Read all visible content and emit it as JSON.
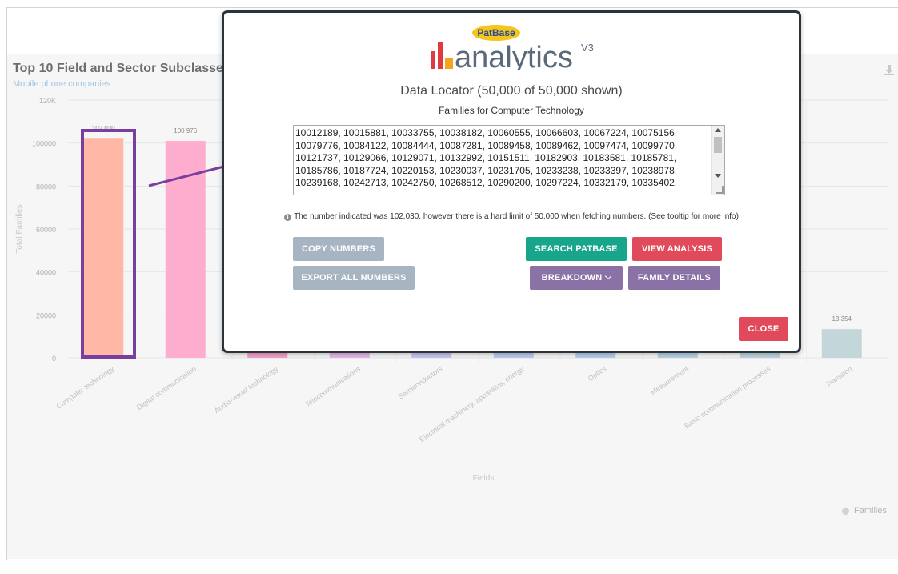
{
  "chart": {
    "title": "Top 10 Field and Sector Subclasses",
    "subtitle": "Mobile phone companies",
    "download_icon": "download-icon",
    "legend_label": "Families"
  },
  "chart_data": {
    "type": "bar",
    "title": "Top 10 Field and Sector Subclasses",
    "subtitle": "Mobile phone companies",
    "xlabel": "Fields",
    "ylabel": "Total Families",
    "ylim": [
      0,
      120000
    ],
    "yticks": [
      "0",
      "20000",
      "40000",
      "60000",
      "80000",
      "100000",
      "120K"
    ],
    "categories": [
      "Computer technology",
      "Digital communication",
      "Audio-visual technology",
      "Telecommunications",
      "Semiconductors",
      "Electrical machinery, apparatus, energy",
      "Optics",
      "Measurement",
      "Basic communication processes",
      "Transport"
    ],
    "series": [
      {
        "name": "Families",
        "values": [
          102030,
          100976,
          0,
          0,
          0,
          0,
          0,
          0,
          0,
          13354
        ]
      }
    ],
    "data_labels": [
      "102 030",
      "100 976",
      "",
      "",
      "",
      "",
      "",
      "",
      "",
      "13 354"
    ],
    "bar_colors": [
      "#ffb8a6",
      "#ffadcf",
      "#f3a1c8",
      "#e3b9e6",
      "#c9c5ee",
      "#b9cdee",
      "#b5cdec",
      "#b7d2e6",
      "#bcd5dd",
      "#c3d7da"
    ],
    "grid": true,
    "legend_placement": "bottom-right"
  },
  "modal": {
    "logo_brand": "PatBase",
    "logo_word": "analytics",
    "logo_version": "V3",
    "heading": "Data Locator (50,000 of 50,000 shown)",
    "subheading": "Families for Computer Technology",
    "numbers_text": "10012189, 10015881, 10033755, 10038182, 10060555, 10066603, 10067224, 10075156, 10079776, 10084122, 10084444, 10087281, 10089458, 10089462, 10097474, 10099770, 10121737, 10129066, 10129071, 10132992, 10151511, 10182903, 10183581, 10185781, 10185786, 10187724, 10220153, 10230037, 10231705, 10233238, 10233397, 10238978, 10239168, 10242713, 10242750, 10268512, 10290200, 10297224, 10332179, 10335402,",
    "notice": "The number indicated was 102,030, however there is a hard limit of 50,000 when fetching numbers. (See tooltip for more info)",
    "buttons": {
      "copy_numbers": "COPY NUMBERS",
      "export_all": "EXPORT ALL NUMBERS",
      "search_patbase": "SEARCH PATBASE",
      "view_analysis": "VIEW ANALYSIS",
      "breakdown": "BREAKDOWN",
      "family_details": "FAMILY DETAILS",
      "close": "CLOSE"
    },
    "colors": {
      "teal": "#17a58c",
      "red": "#e04a5a",
      "purple": "#8a72a6",
      "gray": "#a7b4c2",
      "annotation": "#7a3e9f"
    }
  }
}
